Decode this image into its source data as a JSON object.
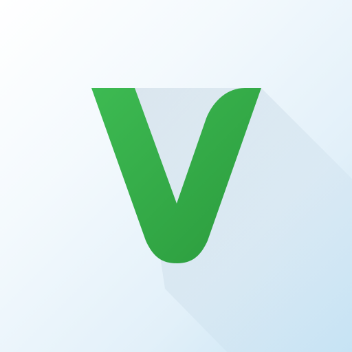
{
  "icon": {
    "name": "v-logo",
    "glyph": "V",
    "colors": {
      "background_light": "#ffffff",
      "background_dark": "#c6e3f4",
      "logo_green_light": "#3dba52",
      "logo_green_dark": "#2b9b3d",
      "shadow": "#9fb9cc"
    }
  }
}
